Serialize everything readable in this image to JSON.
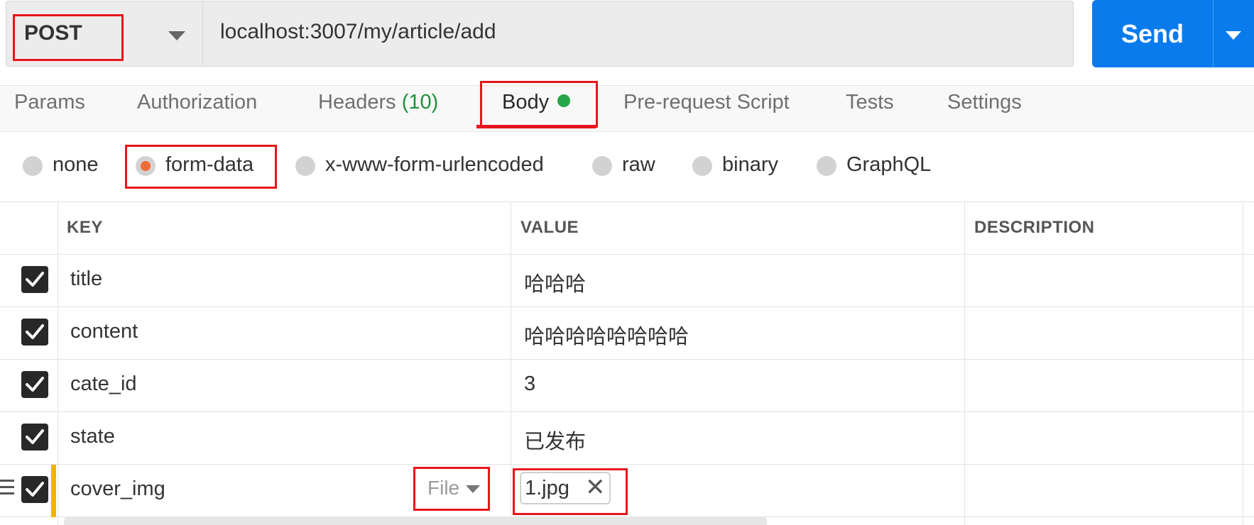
{
  "request": {
    "method": "POST",
    "url": "localhost:3007/my/article/add",
    "send_label": "Send"
  },
  "tabs": [
    {
      "label": "Params"
    },
    {
      "label": "Authorization"
    },
    {
      "label": "Headers",
      "count": "(10)"
    },
    {
      "label": "Body"
    },
    {
      "label": "Pre-request Script"
    },
    {
      "label": "Tests"
    },
    {
      "label": "Settings"
    }
  ],
  "body_types": [
    "none",
    "form-data",
    "x-www-form-urlencoded",
    "raw",
    "binary",
    "GraphQL"
  ],
  "body_type_selected": "form-data",
  "table": {
    "headers": [
      "KEY",
      "VALUE",
      "DESCRIPTION"
    ],
    "rows": [
      {
        "key": "title",
        "value": "哈哈哈",
        "description": ""
      },
      {
        "key": "content",
        "value": "哈哈哈哈哈哈哈哈",
        "description": ""
      },
      {
        "key": "cate_id",
        "value": "3",
        "description": ""
      },
      {
        "key": "state",
        "value": "已发布",
        "description": ""
      },
      {
        "key": "cover_img",
        "type": "File",
        "value": "1.jpg",
        "description": ""
      }
    ]
  },
  "colors": {
    "send": "#097bed",
    "highlight_box": "#e8141b",
    "body_dot": "#26a648",
    "headers_count": "#22913a",
    "radio_selected": "#f26b3a",
    "row_accent": "#f0b400"
  },
  "icons": [
    "chevron-down-icon",
    "check-icon",
    "close-icon",
    "drag-handle-icon"
  ]
}
